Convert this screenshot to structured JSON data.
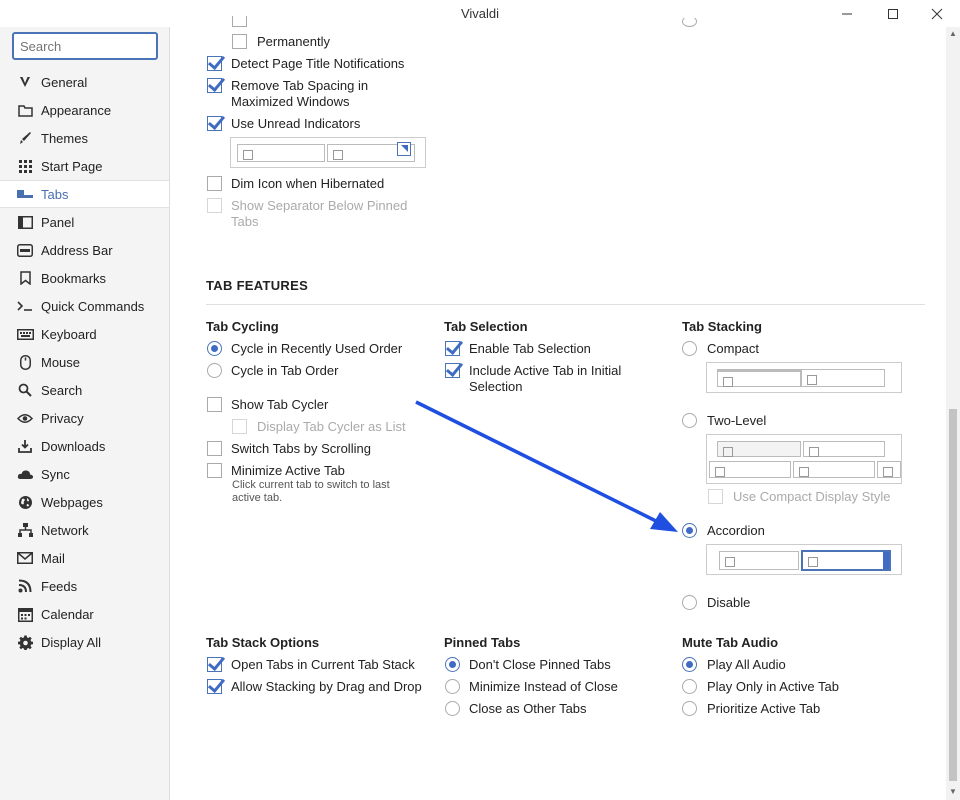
{
  "window": {
    "title": "Vivaldi"
  },
  "search": {
    "placeholder": "Search"
  },
  "sidebar": {
    "items": [
      {
        "label": "General",
        "icon": "vivaldi-v-icon"
      },
      {
        "label": "Appearance",
        "icon": "folder-icon"
      },
      {
        "label": "Themes",
        "icon": "brush-icon"
      },
      {
        "label": "Start Page",
        "icon": "grid-icon"
      },
      {
        "label": "Tabs",
        "icon": "tabs-icon",
        "active": true
      },
      {
        "label": "Panel",
        "icon": "panel-icon"
      },
      {
        "label": "Address Bar",
        "icon": "address-bar-icon"
      },
      {
        "label": "Bookmarks",
        "icon": "bookmark-icon"
      },
      {
        "label": "Quick Commands",
        "icon": "quick-commands-icon"
      },
      {
        "label": "Keyboard",
        "icon": "keyboard-icon"
      },
      {
        "label": "Mouse",
        "icon": "mouse-icon"
      },
      {
        "label": "Search",
        "icon": "search-icon"
      },
      {
        "label": "Privacy",
        "icon": "eye-icon"
      },
      {
        "label": "Downloads",
        "icon": "download-icon"
      },
      {
        "label": "Sync",
        "icon": "cloud-icon"
      },
      {
        "label": "Webpages",
        "icon": "globe-icon"
      },
      {
        "label": "Network",
        "icon": "network-icon"
      },
      {
        "label": "Mail",
        "icon": "mail-icon"
      },
      {
        "label": "Feeds",
        "icon": "rss-icon"
      },
      {
        "label": "Calendar",
        "icon": "calendar-icon"
      },
      {
        "label": "Display All",
        "icon": "gear-icon"
      }
    ]
  },
  "top_options": {
    "permanently": "Permanently",
    "detect_titles": "Detect Page Title Notifications",
    "remove_spacing": "Remove Tab Spacing in Maximized Windows",
    "unread": "Use Unread Indicators",
    "dim_icon": "Dim Icon when Hibernated",
    "separator": "Show Separator Below Pinned Tabs"
  },
  "tab_features": {
    "title": "TAB FEATURES",
    "cycling": {
      "title": "Tab Cycling",
      "recent": "Cycle in Recently Used Order",
      "order": "Cycle in Tab Order",
      "show_cycler": "Show Tab Cycler",
      "cycler_list": "Display Tab Cycler as List",
      "scrolling": "Switch Tabs by Scrolling",
      "minimize": "Minimize Active Tab",
      "minimize_hint": "Click current tab to switch to last active tab."
    },
    "selection": {
      "title": "Tab Selection",
      "enable": "Enable Tab Selection",
      "include_active": "Include Active Tab in Initial Selection"
    },
    "stacking": {
      "title": "Tab Stacking",
      "compact": "Compact",
      "two_level": "Two-Level",
      "use_compact": "Use Compact Display Style",
      "accordion": "Accordion",
      "disable": "Disable",
      "selected": "Accordion"
    },
    "stack_options": {
      "title": "Tab Stack Options",
      "open_current": "Open Tabs in Current Tab Stack",
      "drag_drop": "Allow Stacking by Drag and Drop"
    },
    "pinned": {
      "title": "Pinned Tabs",
      "dont_close": "Don't Close Pinned Tabs",
      "minimize": "Minimize Instead of Close",
      "close_other": "Close as Other Tabs"
    },
    "mute": {
      "title": "Mute Tab Audio",
      "play_all": "Play All Audio",
      "active_only": "Play Only in Active Tab",
      "prioritize": "Prioritize Active Tab"
    }
  },
  "colors": {
    "accent": "#3f6cc2",
    "arrow": "#1f4fe0"
  }
}
